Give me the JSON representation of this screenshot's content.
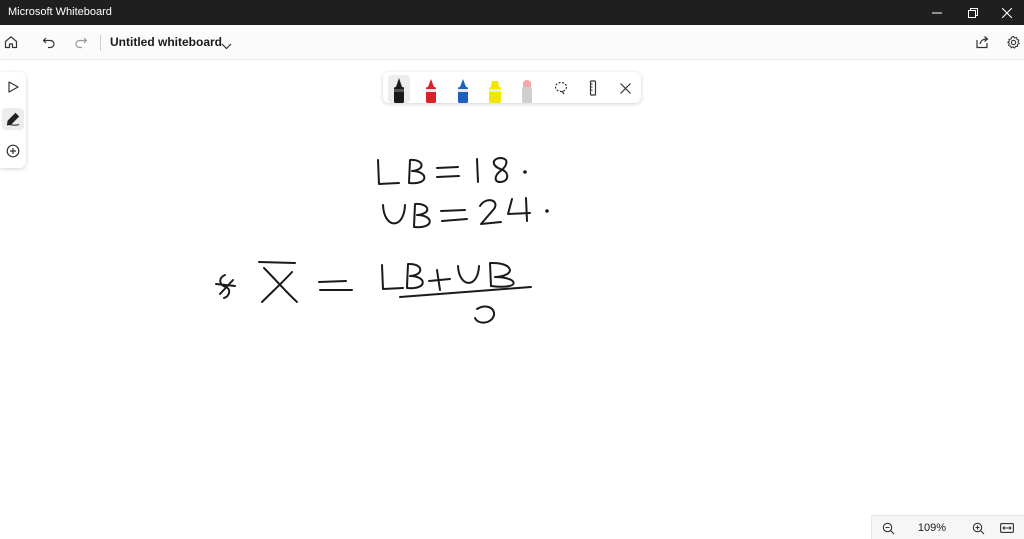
{
  "window": {
    "app_title": "Microsoft Whiteboard",
    "minimize_icon": "minimize-icon",
    "restore_icon": "restore-icon",
    "close_icon": "close-icon"
  },
  "appbar": {
    "home_icon": "home-icon",
    "undo_icon": "undo-icon",
    "redo_icon": "redo-icon",
    "document_title": "Untitled whiteboard",
    "share_icon": "share-icon",
    "settings_icon": "gear-icon"
  },
  "tool_rail": [
    {
      "name": "select-tool",
      "icon": "pointer-icon",
      "active": false
    },
    {
      "name": "ink-tool",
      "icon": "pen-icon",
      "active": true
    },
    {
      "name": "add-tool",
      "icon": "plus-circle-icon",
      "active": false
    }
  ],
  "pen_tray": {
    "pens": [
      {
        "name": "black-pen",
        "color": "#1a1a1a",
        "selected": true
      },
      {
        "name": "red-pen",
        "color": "#d8232a",
        "selected": false
      },
      {
        "name": "blue-pen",
        "color": "#1f5fbf",
        "selected": false
      },
      {
        "name": "yellow-highlighter",
        "color": "#f2e600",
        "selected": false
      },
      {
        "name": "eraser",
        "color": "#f4a9a9",
        "selected": false
      }
    ],
    "lasso_icon": "lasso-icon",
    "ruler_icon": "ruler-icon",
    "close_icon": "close-icon"
  },
  "canvas": {
    "ink_color": "#1a1a1a",
    "handwriting": "LB = 18. UB = 24. x̄ = (LB + UB) / 2"
  },
  "zoom": {
    "zoom_out_icon": "zoom-out-icon",
    "level": "109%",
    "zoom_in_icon": "zoom-in-icon",
    "fit_icon": "fit-to-screen-icon"
  }
}
